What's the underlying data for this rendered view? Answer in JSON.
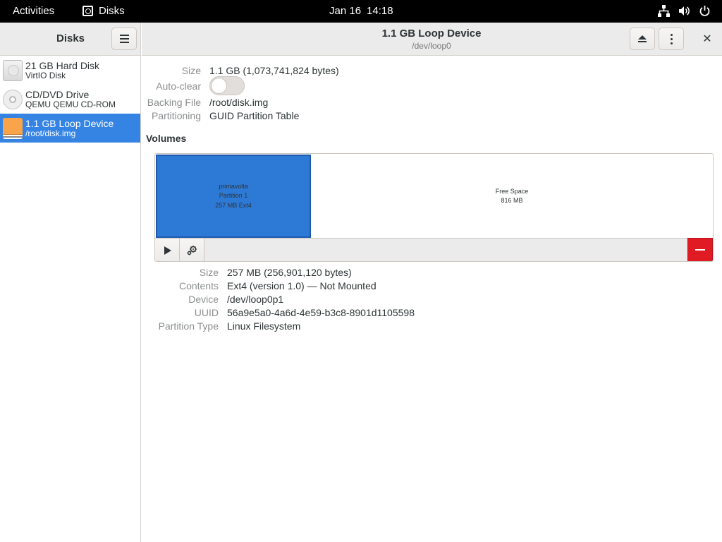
{
  "topbar": {
    "activities": "Activities",
    "app_name": "Disks",
    "date": "Jan 16",
    "time": "14:18",
    "tray_icons": [
      "network-icon",
      "volume-icon",
      "power-icon"
    ]
  },
  "sidebar": {
    "title": "Disks",
    "items": [
      {
        "name": "21 GB Hard Disk",
        "sub": "VirtIO Disk",
        "icon": "hard-disk-icon"
      },
      {
        "name": "CD/DVD Drive",
        "sub": "QEMU QEMU CD-ROM",
        "icon": "optical-drive-icon"
      },
      {
        "name": "1.1 GB Loop Device",
        "sub": "/root/disk.img",
        "icon": "loop-device-icon",
        "selected": true
      }
    ]
  },
  "header": {
    "title": "1.1 GB Loop Device",
    "subtitle": "/dev/loop0",
    "close_glyph": "✕"
  },
  "device_info": {
    "size_label": "Size",
    "size_value": "1.1 GB (1,073,741,824 bytes)",
    "autoclear_label": "Auto-clear",
    "autoclear_on": false,
    "backing_label": "Backing File",
    "backing_value": "/root/disk.img",
    "partitioning_label": "Partitioning",
    "partitioning_value": "GUID Partition Table"
  },
  "volumes": {
    "heading": "Volumes",
    "partition": {
      "name": "primavolta",
      "number": "Partition 1",
      "detail": "257 MB Ext4"
    },
    "free_space": {
      "label": "Free Space",
      "size": "816 MB"
    }
  },
  "partition_info": {
    "size_label": "Size",
    "size_value": "257 MB (256,901,120 bytes)",
    "contents_label": "Contents",
    "contents_value": "Ext4 (version 1.0) — Not Mounted",
    "device_label": "Device",
    "device_value": "/dev/loop0p1",
    "uuid_label": "UUID",
    "uuid_value": "56a9e5a0-4a6d-4e59-b3c8-8901d1105598",
    "type_label": "Partition Type",
    "type_value": "Linux Filesystem"
  },
  "colors": {
    "accent": "#3584e4",
    "partition": "#2c7ad6",
    "destructive": "#e01b24"
  }
}
